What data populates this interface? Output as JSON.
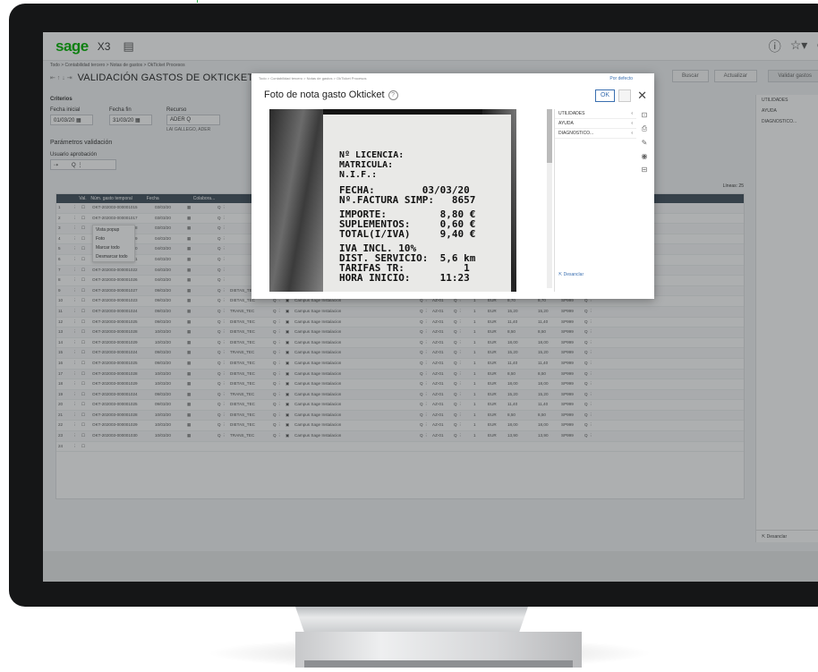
{
  "app": {
    "logo": "sage",
    "product": "X3"
  },
  "breadcrumb": "Todo > Contabilidad tercero > Notas de gastos > OkTicket Procesos",
  "page_title": "VALIDACIÓN GASTOS DE OKTICKET",
  "buttons": {
    "buscar": "Buscar",
    "actualizar": "Actualizar",
    "validar": "Validar gastos"
  },
  "right_panel": {
    "items": [
      "UTILIDADES",
      "AYUDA",
      "DIAGNOSTICO..."
    ],
    "footer": "Desanclar"
  },
  "criteria": {
    "title": "Criterios",
    "fecha_inicial_label": "Fecha inicial",
    "fecha_inicial": "01/03/20",
    "fecha_fin_label": "Fecha fin",
    "fecha_fin": "31/03/20",
    "recurso_label": "Recurso",
    "recurso_value": "ADER",
    "recurso_name": "LAI GALLEGO, ADER",
    "params_title": "Parámetros validación",
    "usuario_label": "Usuario aprobación"
  },
  "grid": {
    "total_label": "Líneas: 25",
    "headers": [
      "",
      "",
      "Val.",
      "Núm. gasto temporal",
      "Fecha",
      "",
      "Colabora...",
      "",
      "",
      "",
      "",
      "",
      "",
      "",
      "",
      "",
      "",
      "",
      "Importe",
      "Impuesto 3",
      "Importe I..."
    ],
    "rows": [
      {
        "n": "1",
        "id": "OKT-202003-000001015",
        "f": "03/03/20",
        "tipo": "",
        "imp": "8,40",
        "cod": "SP999"
      },
      {
        "n": "2",
        "id": "OKT-202003-000001017",
        "f": "03/03/20",
        "tipo": "",
        "imp": "13,40",
        "cod": "SP999"
      },
      {
        "n": "3",
        "id": "OKT-202003-000001018",
        "f": "03/03/20",
        "tipo": "",
        "imp": "18,60",
        "cod": "SP999"
      },
      {
        "n": "4",
        "id": "OKT-202003-000001019",
        "f": "04/03/20",
        "tipo": "",
        "imp": "10,85",
        "cod": "SP999"
      },
      {
        "n": "5",
        "id": "OKT-202003-000001020",
        "f": "04/03/20",
        "tipo": "",
        "imp": "12,50",
        "cod": "SP999"
      },
      {
        "n": "6",
        "id": "OKT-202003-000001021",
        "f": "04/03/20",
        "tipo": "",
        "imp": "11,15",
        "cod": "SP999"
      },
      {
        "n": "7",
        "id": "OKT-202003-000001022",
        "f": "04/03/20",
        "tipo": "",
        "imp": "8,70",
        "cod": "SP999"
      },
      {
        "n": "8",
        "id": "OKT-202003-000001026",
        "f": "04/03/20",
        "tipo": "",
        "imp": "8,50",
        "cod": "SP999"
      },
      {
        "n": "9",
        "id": "OKT-202003-000001027",
        "f": "09/03/20",
        "tipo": "DIETAS_TEC",
        "imp": "8,50",
        "cod": "SP999"
      },
      {
        "n": "10",
        "id": "OKT-202003-000001023",
        "f": "09/03/20",
        "tipo": "DIETAS_TEC",
        "imp": "8,70",
        "cod": "SP999"
      },
      {
        "n": "11",
        "id": "OKT-202003-000001024",
        "f": "09/03/20",
        "tipo": "TRANS_TEC",
        "imp": "15,20",
        "cod": "SP999"
      },
      {
        "n": "12",
        "id": "OKT-202003-000001025",
        "f": "09/03/20",
        "tipo": "DIETAS_TEC",
        "imp": "11,40",
        "cod": "SP999"
      },
      {
        "n": "13",
        "id": "OKT-202003-000001028",
        "f": "10/03/20",
        "tipo": "DIETAS_TEC",
        "imp": "8,50",
        "cod": "SP999"
      },
      {
        "n": "14",
        "id": "OKT-202003-000001029",
        "f": "10/03/20",
        "tipo": "DIETAS_TEC",
        "imp": "18,00",
        "cod": "SP999"
      },
      {
        "n": "15",
        "id": "OKT-202003-000001024",
        "f": "09/03/20",
        "tipo": "TRANS_TEC",
        "imp": "15,20",
        "cod": "SP999"
      },
      {
        "n": "16",
        "id": "OKT-202003-000001025",
        "f": "09/03/20",
        "tipo": "DIETAS_TEC",
        "imp": "11,40",
        "cod": "SP999"
      },
      {
        "n": "17",
        "id": "OKT-202003-000001028",
        "f": "10/03/20",
        "tipo": "DIETAS_TEC",
        "imp": "8,50",
        "cod": "SP999"
      },
      {
        "n": "18",
        "id": "OKT-202003-000001029",
        "f": "10/03/20",
        "tipo": "DIETAS_TEC",
        "imp": "18,00",
        "cod": "SP999"
      },
      {
        "n": "19",
        "id": "OKT-202003-000001024",
        "f": "09/03/20",
        "tipo": "TRANS_TEC",
        "imp": "15,20",
        "cod": "SP999"
      },
      {
        "n": "20",
        "id": "OKT-202003-000001025",
        "f": "09/03/20",
        "tipo": "DIETAS_TEC",
        "imp": "11,40",
        "cod": "SP999"
      },
      {
        "n": "21",
        "id": "OKT-202003-000001028",
        "f": "10/03/20",
        "tipo": "DIETAS_TEC",
        "imp": "8,50",
        "cod": "SP999"
      },
      {
        "n": "22",
        "id": "OKT-202003-000001029",
        "f": "10/03/20",
        "tipo": "DIETAS_TEC",
        "imp": "18,00",
        "cod": "SP999"
      },
      {
        "n": "23",
        "id": "OKT-202003-000001030",
        "f": "10/03/20",
        "tipo": "TRANS_TEC",
        "imp": "13,90",
        "cod": "SP999"
      },
      {
        "n": "24",
        "id": "",
        "f": "",
        "tipo": "",
        "imp": "",
        "cod": ""
      }
    ],
    "site": "Campus Sage Instalacion",
    "currency": "EUR",
    "account": "AZ-01"
  },
  "context_menu": [
    "Vista popup",
    "Foto",
    "Marcar todo",
    "Desmarcar todo"
  ],
  "modal": {
    "breadcrumb": "Todo > Contabilidad tercero > Notas de gastos > OkTicket Procesos",
    "default_label": "Por defecto",
    "title": "Foto de nota gasto Okticket",
    "ok": "OK",
    "side_items": [
      "UTILIDADES",
      "AYUDA",
      "DIAGNOSTICO..."
    ],
    "desanclar": "Desanclar",
    "receipt": [
      "Nº LICENCIA:",
      "MATRICULA:",
      "N.I.F.:",
      "FECHA:        03/03/20",
      "Nº.FACTURA SIMP:   8657",
      "IMPORTE:         8,80 €",
      "SUPLEMENTOS:     0,60 €",
      "TOTAL(I/IVA)     9,40 €",
      "IVA INCL. 10%",
      "DIST. SERVICIO:  5,6 km",
      "TARIFAS TR:          1",
      "HORA INICIO:     11:23"
    ]
  },
  "colors": {
    "sage_green": "#00b400",
    "header_dark": "#3f4e5b",
    "link_blue": "#3a6fb0"
  }
}
